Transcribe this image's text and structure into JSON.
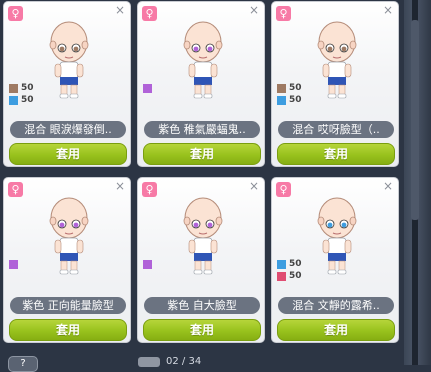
{
  "colors": {
    "accent_green": "#9cc425",
    "gender_pink": "#f77aa6",
    "pill_gray": "#6b7381"
  },
  "cards": [
    {
      "gender_icon": "♀",
      "close_icon": "×",
      "swatches": [
        {
          "color": "#9e7a63",
          "value": "50"
        },
        {
          "color": "#3d9de0",
          "value": "50"
        }
      ],
      "name": "混合 眼淚爆發倒..",
      "apply": "套用"
    },
    {
      "gender_icon": "♀",
      "close_icon": "×",
      "swatches": [
        {
          "color": "#b062d8",
          "value": ""
        }
      ],
      "name": "紫色 稚氣嚴蝠鬼..",
      "apply": "套用"
    },
    {
      "gender_icon": "♀",
      "close_icon": "×",
      "swatches": [
        {
          "color": "#9e7a63",
          "value": "50"
        },
        {
          "color": "#3d9de0",
          "value": "50"
        }
      ],
      "name": "混合 哎呀臉型（..",
      "apply": "套用"
    },
    {
      "gender_icon": "♀",
      "close_icon": "×",
      "swatches": [
        {
          "color": "#b062d8",
          "value": ""
        }
      ],
      "name": "紫色 正向能量臉型",
      "apply": "套用"
    },
    {
      "gender_icon": "♀",
      "close_icon": "×",
      "swatches": [
        {
          "color": "#b062d8",
          "value": ""
        }
      ],
      "name": "紫色 自大臉型",
      "apply": "套用"
    },
    {
      "gender_icon": "♀",
      "close_icon": "×",
      "swatches": [
        {
          "color": "#3d9de0",
          "value": "50"
        },
        {
          "color": "#e04d72",
          "value": "50"
        }
      ],
      "name": "混合 文靜的露希..",
      "apply": "套用"
    }
  ],
  "footer": {
    "help": "?",
    "page": "02 / 34"
  }
}
